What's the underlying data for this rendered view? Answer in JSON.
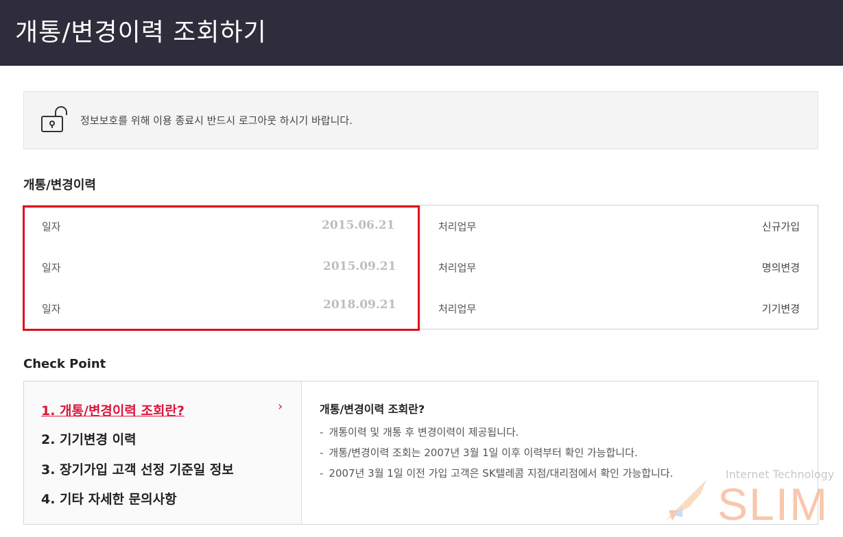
{
  "header": {
    "title": "개통/변경이력 조회하기"
  },
  "notice": {
    "message": "정보보호를 위해 이용 종료시 반드시 로그아웃 하시기 바랍니다."
  },
  "history": {
    "section_title": "개통/변경이력",
    "rows": [
      {
        "date_label": "일자",
        "date": "2015.06.21",
        "task_label": "처리업무",
        "task": "신규가입"
      },
      {
        "date_label": "일자",
        "date": "2015.09.21",
        "task_label": "처리업무",
        "task": "명의변경"
      },
      {
        "date_label": "일자",
        "date": "2018.09.21",
        "task_label": "처리업무",
        "task": "기기변경"
      }
    ]
  },
  "checkpoint": {
    "section_title": "Check Point",
    "items": [
      {
        "label": "1. 개통/변경이력 조회란?"
      },
      {
        "label": "2. 기기변경 이력"
      },
      {
        "label": "3. 장기가입 고객 선정 기준일 정보"
      },
      {
        "label": "4. 기타 자세한 문의사항"
      }
    ],
    "active_index": 0,
    "detail": {
      "heading": "개통/변경이력 조회란?",
      "lines": [
        "개통이력 및 개통 후 변경이력이 제공됩니다.",
        "개통/변경이력 조회는 2007년 3월 1일 이후 이력부터 확인 가능합니다.",
        "2007년 3월 1일 이전 가입 고객은 SK텔레콤 지점/대리점에서 확인 가능합니다."
      ]
    }
  },
  "watermark": {
    "small": "Internet Technology",
    "big": "SLIM"
  },
  "icons": {
    "lock": "unlock-icon",
    "chevron": "chevron-right-icon"
  },
  "colors": {
    "header_bg": "#2f2d3b",
    "accent": "#d9163b",
    "highlight": "#e00d1d"
  }
}
